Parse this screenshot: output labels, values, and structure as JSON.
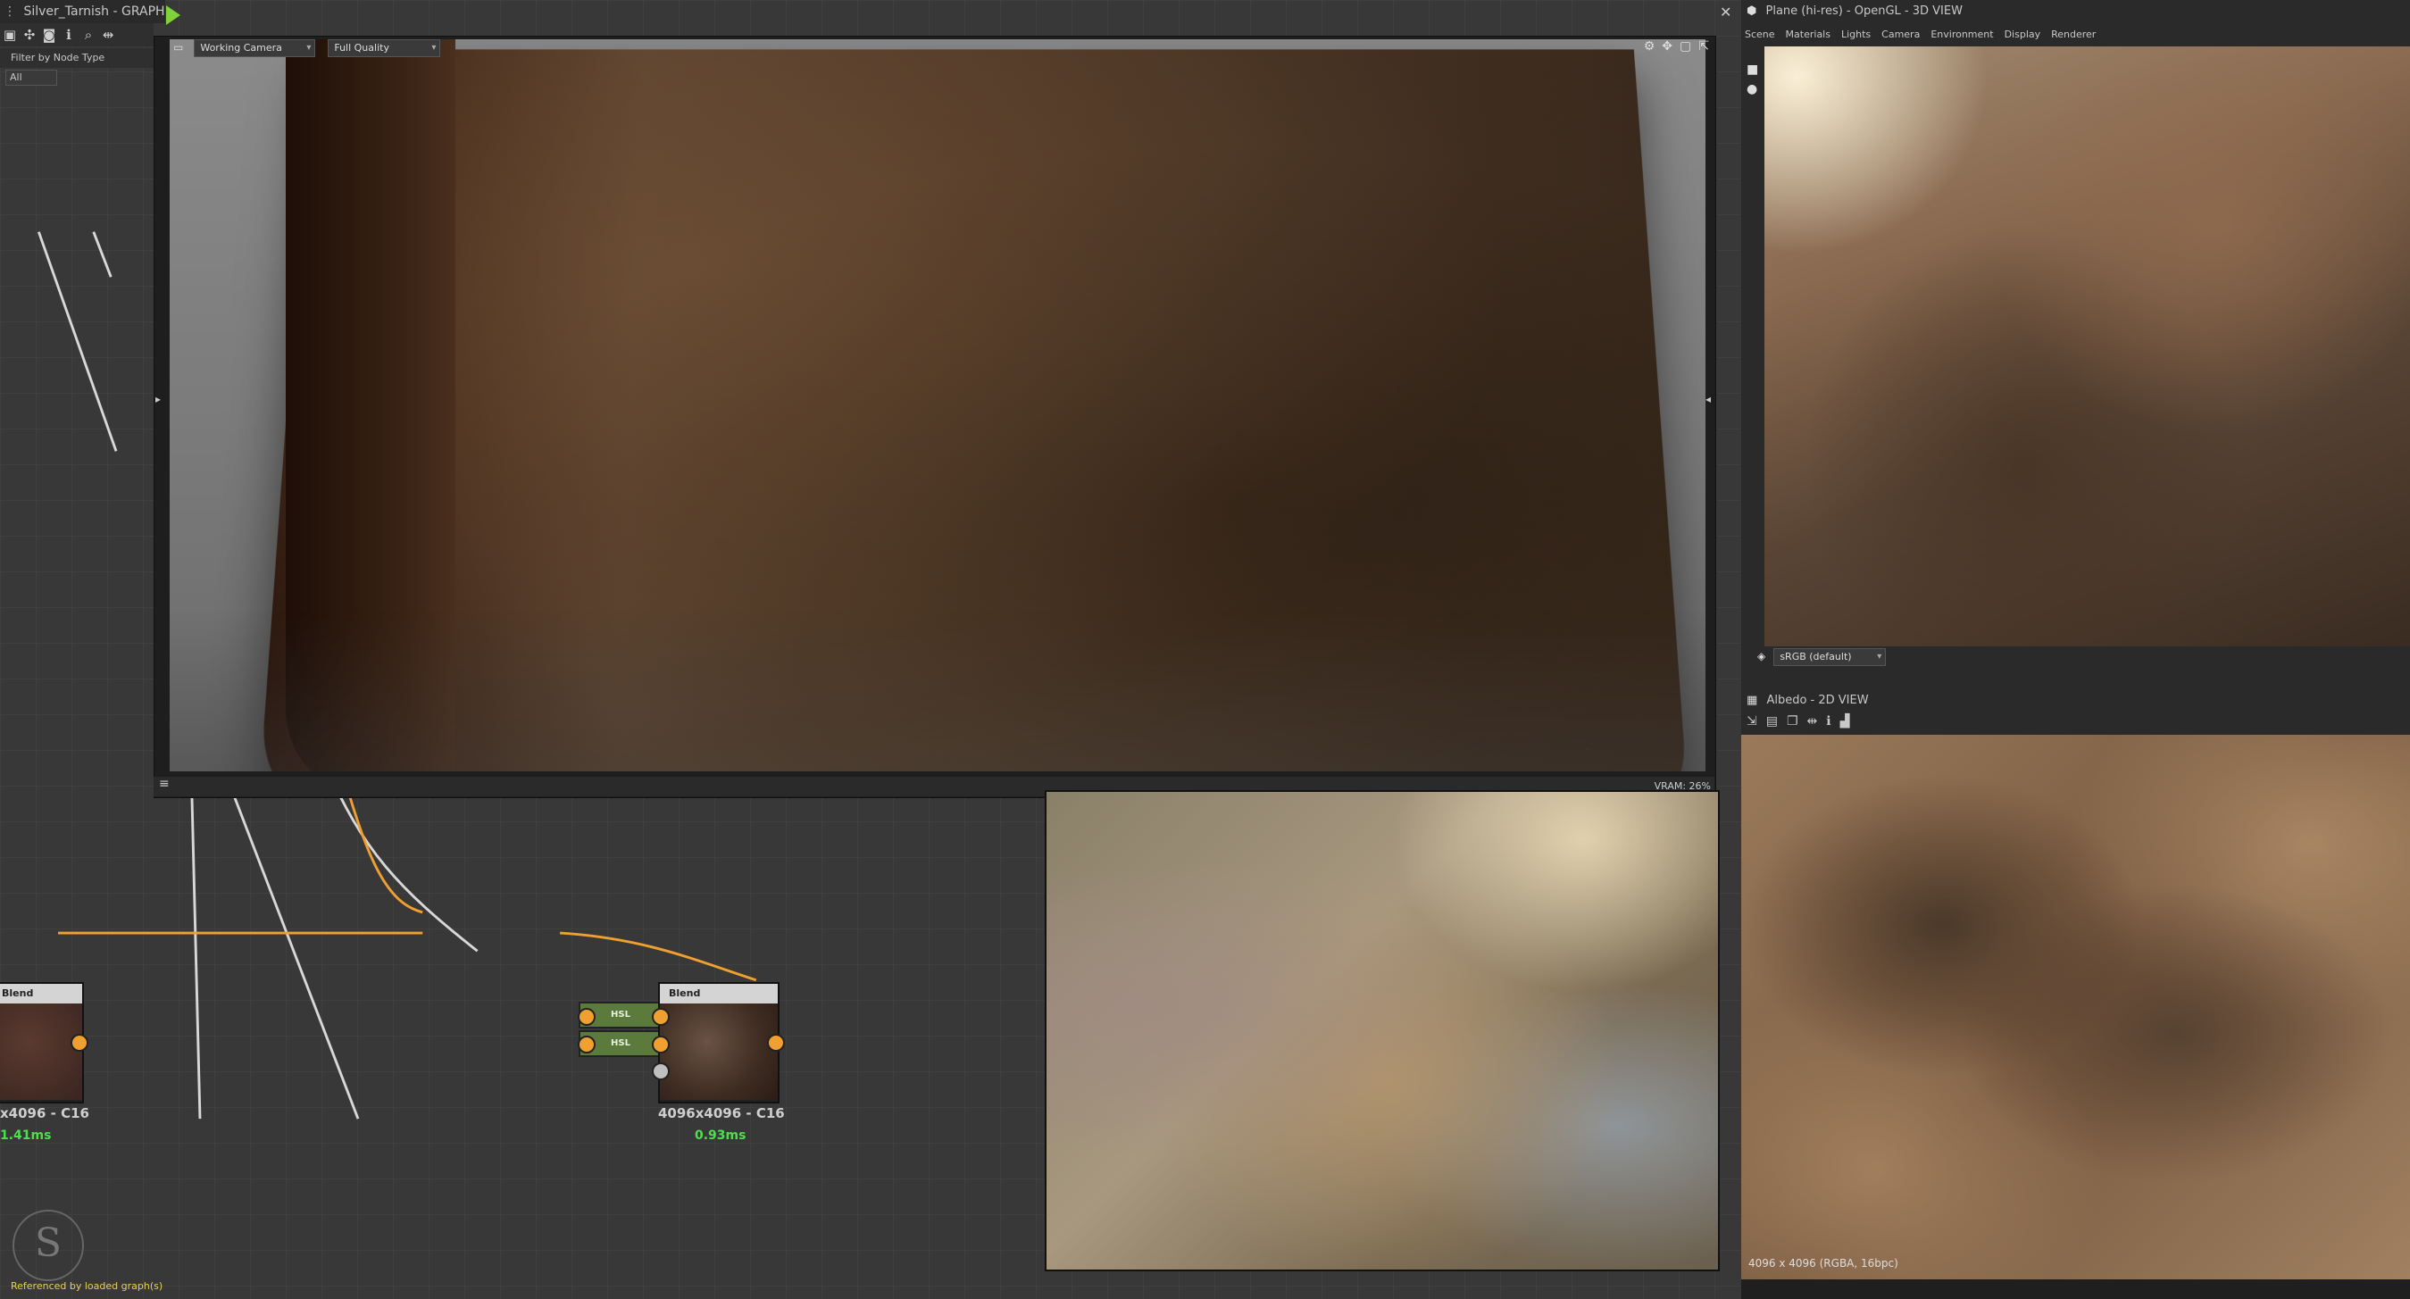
{
  "graph": {
    "title": "Silver_Tarnish - GRAPH",
    "filter_label": "Filter by Node Type",
    "filter_value": "All",
    "toolbar_icons": [
      "frame-icon",
      "fit-icon",
      "camera-icon",
      "info-icon",
      "search-icon",
      "link-icon"
    ]
  },
  "viewport": {
    "camera": "Working Camera",
    "quality": "Full Quality",
    "vram": "VRAM: 26%"
  },
  "nodes": [
    {
      "title": "Blend",
      "caption": "x4096 - C16",
      "time": "1.41ms"
    },
    {
      "title": "Blend",
      "caption": "4096x4096 - C16",
      "time": "0.93ms"
    }
  ],
  "hsl_nodes": [
    "HSL",
    "HSL"
  ],
  "view3d": {
    "title": "Plane (hi-res) - OpenGL - 3D VIEW",
    "menu": [
      "Scene",
      "Materials",
      "Lights",
      "Camera",
      "Environment",
      "Display",
      "Renderer"
    ],
    "colorspace": "sRGB (default)"
  },
  "view2d": {
    "title": "Albedo - 2D VIEW",
    "info": "4096 x 4096 (RGBA, 16bpc)"
  },
  "footer": {
    "referenced": "Referenced by loaded graph(s)"
  },
  "colors": {
    "wire": "#f0a030",
    "time": "#4de04d",
    "hsl": "#5b7a3c"
  }
}
